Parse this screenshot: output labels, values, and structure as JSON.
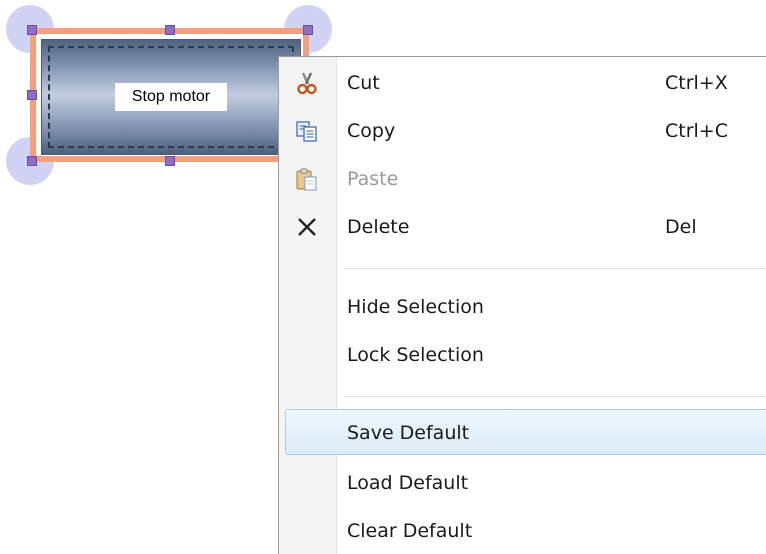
{
  "widget": {
    "label": "Stop motor"
  },
  "context_menu": {
    "items": [
      {
        "label": "Cut",
        "shortcut": "Ctrl+X",
        "icon": "scissors-icon",
        "enabled": true
      },
      {
        "label": "Copy",
        "shortcut": "Ctrl+C",
        "icon": "copy-icon",
        "enabled": true
      },
      {
        "label": "Paste",
        "shortcut": "",
        "icon": "paste-icon",
        "enabled": false
      },
      {
        "label": "Delete",
        "shortcut": "Del",
        "icon": "delete-x-icon",
        "enabled": true
      },
      {
        "label": "Hide Selection",
        "shortcut": "",
        "icon": "",
        "enabled": true
      },
      {
        "label": "Lock Selection",
        "shortcut": "",
        "icon": "",
        "enabled": true
      },
      {
        "label": "Save Default",
        "shortcut": "",
        "icon": "",
        "enabled": true,
        "highlighted": true
      },
      {
        "label": "Load Default",
        "shortcut": "",
        "icon": "",
        "enabled": true
      },
      {
        "label": "Clear Default",
        "shortcut": "",
        "icon": "",
        "enabled": true
      }
    ]
  },
  "colors": {
    "selection_border": "#f4a07f",
    "handle": "#8e6fc6",
    "knob": "#aaafeb",
    "highlight_border": "#a9cde8",
    "disabled_text": "#9a9a9a"
  }
}
